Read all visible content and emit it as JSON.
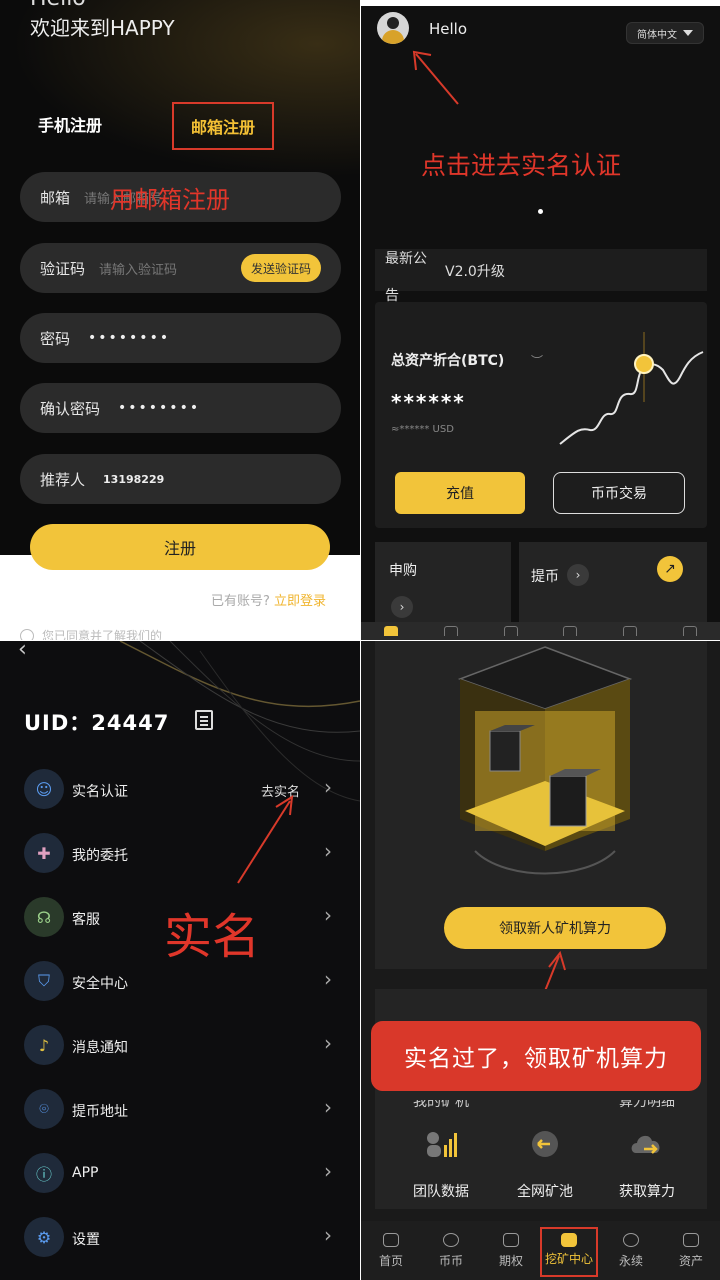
{
  "panel1": {
    "hello_partial": "Hello",
    "welcome": "欢迎来到HAPPY",
    "tab_phone": "手机注册",
    "tab_email": "邮箱注册",
    "email_label": "邮箱",
    "email_placeholder": "请输入邮箱号",
    "email_annotation": "用邮箱注册",
    "code_label": "验证码",
    "code_placeholder": "请输入验证码",
    "send_code": "发送验证码",
    "password_label": "密码",
    "password_value": "••••••••",
    "confirm_label": "确认密码",
    "confirm_value": "••••••••",
    "referrer_label": "推荐人",
    "referrer_value": "13198229",
    "register_button": "注册",
    "have_account": "已有账号?",
    "login_link": "立即登录",
    "agree_text": "您已同意并了解我们的"
  },
  "panel2": {
    "greeting": "Hello",
    "language": "简体中文",
    "annotation": "点击进去实名认证",
    "notice_label_1": "最新公",
    "notice_label_2": "告",
    "notice_text": "V2.0升级",
    "asset_title": "总资产折合(BTC)",
    "asset_hidden": "******",
    "asset_usd": "≈****** USD",
    "recharge": "充值",
    "coin_trade": "币币交易",
    "subscribe": "申购",
    "withdraw": "提币"
  },
  "panel3": {
    "uid": "UID：24447",
    "annotation": "实名",
    "menu": [
      {
        "label": "实名认证",
        "right": "去实名"
      },
      {
        "label": "我的委托",
        "right": ""
      },
      {
        "label": "客服",
        "right": ""
      },
      {
        "label": "安全中心",
        "right": ""
      },
      {
        "label": "消息通知",
        "right": ""
      },
      {
        "label": "提币地址",
        "right": ""
      },
      {
        "label": "APP",
        "right": ""
      },
      {
        "label": "设置",
        "right": ""
      }
    ]
  },
  "panel4": {
    "claim_button": "领取新人矿机算力",
    "annotation": "实名过了，领取矿机算力",
    "partial_left": "我的矿机",
    "partial_right": "算力明细",
    "features": [
      {
        "label": "团队数据",
        "icon": "team-data-icon"
      },
      {
        "label": "全网矿池",
        "icon": "mining-pool-icon"
      },
      {
        "label": "获取算力",
        "icon": "get-hashrate-icon"
      }
    ],
    "nav": [
      "首页",
      "币币",
      "期权",
      "挖矿中心",
      "永续",
      "资产"
    ]
  },
  "colors": {
    "accent": "#f2c43a",
    "annotation_red": "#d83a2a"
  }
}
